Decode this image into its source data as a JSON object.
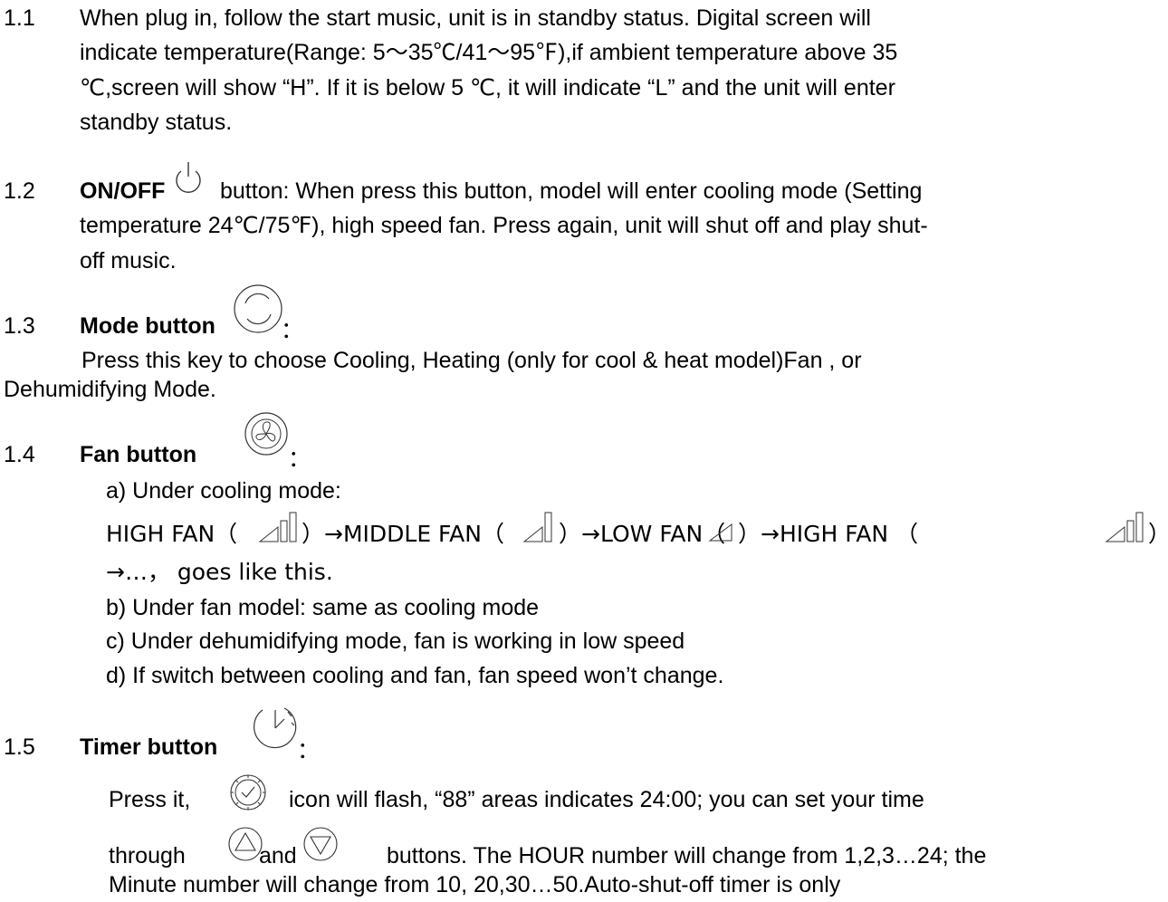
{
  "s11": {
    "num": "1.1",
    "l1": "When plug in, follow the start music, unit is in standby status. Digital screen will",
    "l2": "indicate temperature(Range: 5～35℃/41～95℉),if ambient temperature above 35",
    "l3": "℃,screen will show “H”. If it is below 5  ℃, it will indicate “L” and the unit will enter",
    "l4": "standby status."
  },
  "s12": {
    "num": "1.2",
    "bold": "ON/OFF",
    "l1": "button: When press this button, model will enter cooling mode (Setting",
    "l2": "temperature 24℃/75℉), high speed fan. Press again, unit will shut off and play shut-",
    "l3": "off music."
  },
  "s13": {
    "num": "1.3",
    "bold": "Mode button",
    "colon": "：",
    "l1": "Press this key to choose Cooling, Heating (only for cool & heat model)Fan , or",
    "l2": "Dehumidifying Mode."
  },
  "s14": {
    "num": "1.4",
    "bold": "Fan button",
    "colon": "：",
    "a": "a) Under cooling mode:",
    "seq_high": "HIGH FAN（",
    "seq_middle": "）→MIDDLE FAN（",
    "seq_low": "）→LOW FAN（",
    "seq_high2": "）→HIGH   FAN （",
    "seq_end": "）",
    "seq_cont": "→…，  goes like this.",
    "b": "b) Under fan model: same as cooling mode",
    "c": "c) Under dehumidifying mode, fan is working in low speed",
    "d": "d) If switch between cooling and fan, fan speed won’t change."
  },
  "s15": {
    "num": "1.5",
    "bold": "Timer button",
    "colon": "：",
    "p1a": "Press it,",
    "p1b": "icon will flash, “88” areas indicates 24:00; you can set your time",
    "p2a": "through",
    "p2b": "and",
    "p2c": "buttons. The HOUR number will change from 1,2,3…24; the",
    "p3": "Minute number will change from 10, 20,30…50.Auto-shut-off timer is only"
  },
  "icons": [
    "power-icon",
    "mode-icon",
    "fan-icon",
    "fan-high-icon",
    "fan-middle-icon",
    "fan-low-icon",
    "timer-icon",
    "clock-icon",
    "up-arrow-icon",
    "down-arrow-icon"
  ]
}
